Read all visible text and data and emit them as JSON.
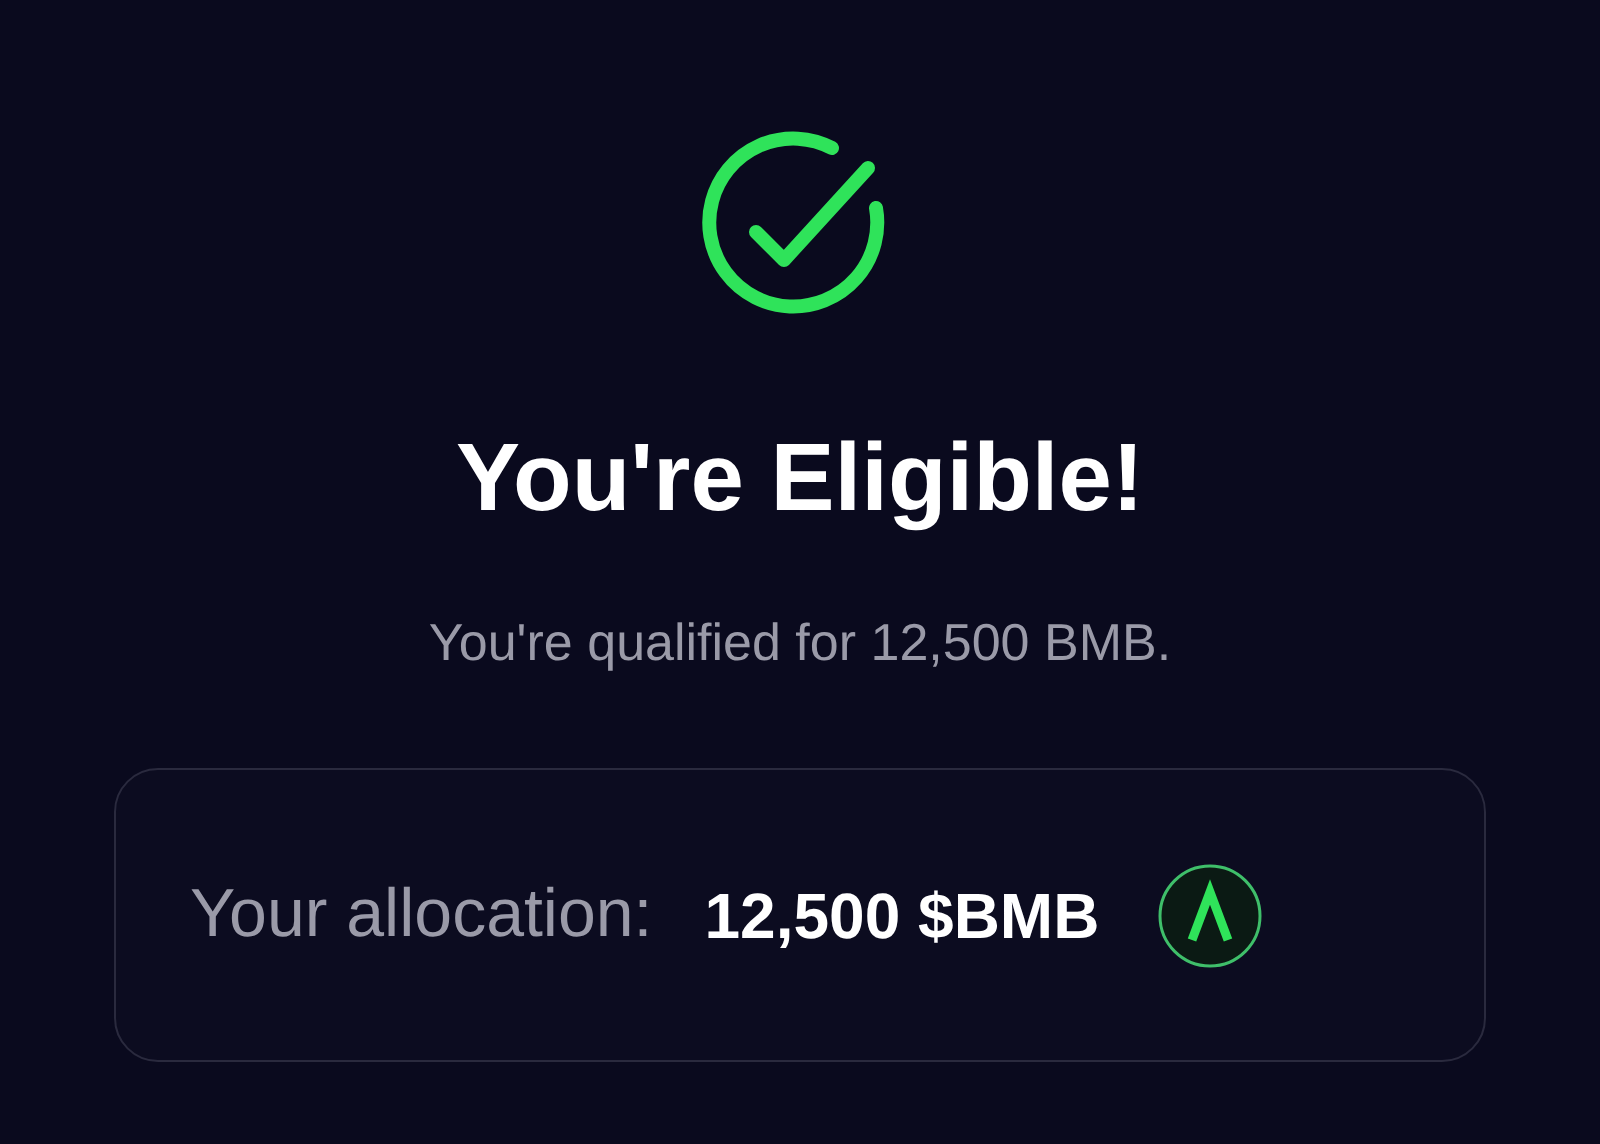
{
  "title": "You're Eligible!",
  "subtitle": "You're qualified for 12,500 BMB.",
  "allocation": {
    "label": "Your allocation:",
    "amount": "12,500 $BMB"
  }
}
